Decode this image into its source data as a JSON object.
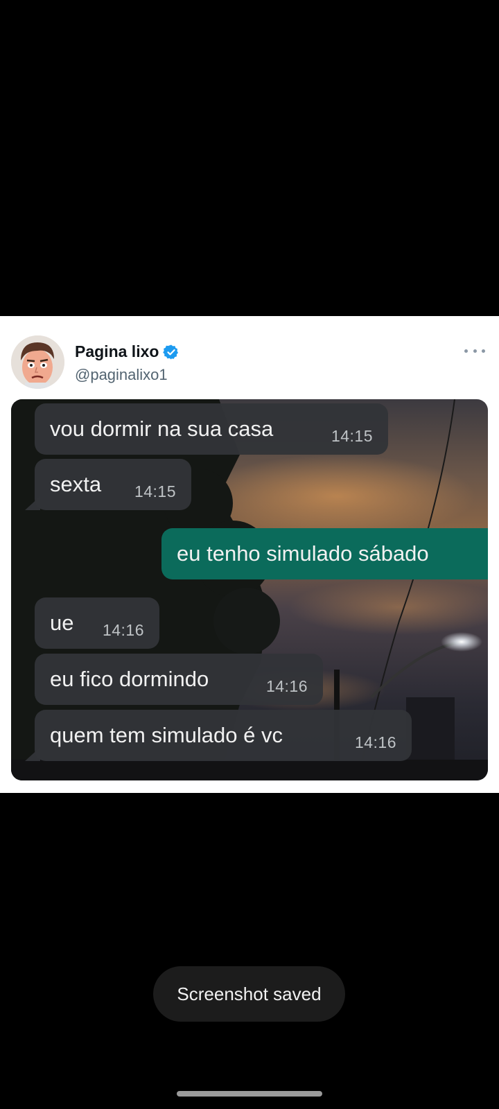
{
  "tweet": {
    "author_name": "Pagina lixo",
    "verified_icon": "verified-badge-icon",
    "handle": "@paginalixo1",
    "more_icon": "more-options-icon"
  },
  "messages": [
    {
      "text": "vou dormir na sua casa",
      "time": "14:15",
      "direction": "incoming"
    },
    {
      "text": "sexta",
      "time": "14:15",
      "direction": "incoming"
    },
    {
      "text": "eu tenho simulado sábado",
      "time": "",
      "direction": "outgoing"
    },
    {
      "text": "ue",
      "time": "14:16",
      "direction": "incoming"
    },
    {
      "text": "eu fico dormindo",
      "time": "14:16",
      "direction": "incoming"
    },
    {
      "text": "quem tem simulado é vc",
      "time": "14:16",
      "direction": "incoming"
    }
  ],
  "toast": {
    "text": "Screenshot saved"
  },
  "colors": {
    "incoming_bubble": "#313438",
    "outgoing_bubble": "#0b6b5b",
    "verified": "#1d9bf0"
  }
}
